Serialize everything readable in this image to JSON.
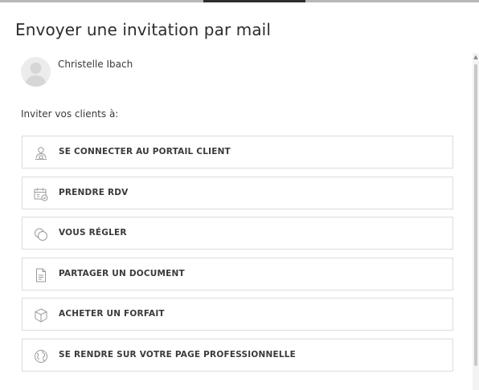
{
  "dialog": {
    "title": "Envoyer une invitation par mail"
  },
  "client": {
    "name": "Christelle Ibach",
    "avatar_icon": "person-silhouette-icon"
  },
  "invite": {
    "label": "Inviter vos clients à:",
    "actions": [
      {
        "label": "SE CONNECTER AU PORTAIL CLIENT",
        "icon": "user-portal-icon"
      },
      {
        "label": "PRENDRE RDV",
        "icon": "calendar-icon"
      },
      {
        "label": "VOUS RÉGLER",
        "icon": "coins-icon"
      },
      {
        "label": "PARTAGER UN DOCUMENT",
        "icon": "document-icon"
      },
      {
        "label": "ACHETER UN FORFAIT",
        "icon": "package-box-icon"
      },
      {
        "label": "SE RENDRE SUR VOTRE PAGE PROFESSIONNELLE",
        "icon": "globe-icon"
      }
    ]
  },
  "colors": {
    "border": "#dcdcdc",
    "text": "#3a3a3a",
    "icon": "#9a9a9a",
    "accent_bar": "#2d2d2d"
  }
}
